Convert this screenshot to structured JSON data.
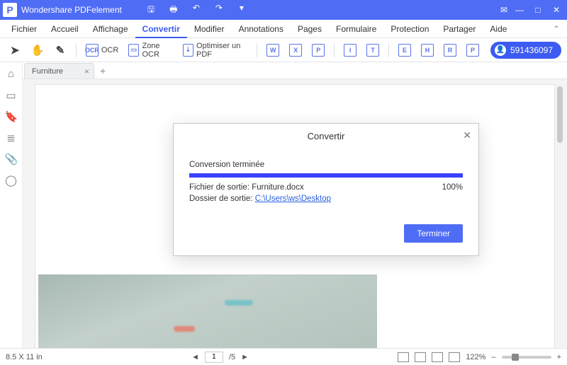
{
  "titlebar": {
    "app_name": "Wondershare PDFelement"
  },
  "menu": {
    "items": [
      "Fichier",
      "Accueil",
      "Affichage",
      "Convertir",
      "Modifier",
      "Annotations",
      "Pages",
      "Formulaire",
      "Protection",
      "Partager",
      "Aide"
    ],
    "active_index": 3
  },
  "toolbar": {
    "ocr_label": "OCR",
    "zone_ocr_label": "Zone OCR",
    "optimize_label": "Optimiser un PDF",
    "user_id": "591436097"
  },
  "tab": {
    "name": "Furniture"
  },
  "dialog": {
    "title": "Convertir",
    "status": "Conversion terminée",
    "file_label": "Fichier de sortie: ",
    "file_name": "Furniture.docx",
    "percent": "100%",
    "folder_label": "Dossier de sortie: ",
    "folder_path": "C:\\Users\\ws\\Desktop",
    "finish_btn": "Terminer"
  },
  "status": {
    "dimensions": "8.5 X 11 in",
    "page_current": "1",
    "page_sep": "/5",
    "zoom": "122%"
  }
}
